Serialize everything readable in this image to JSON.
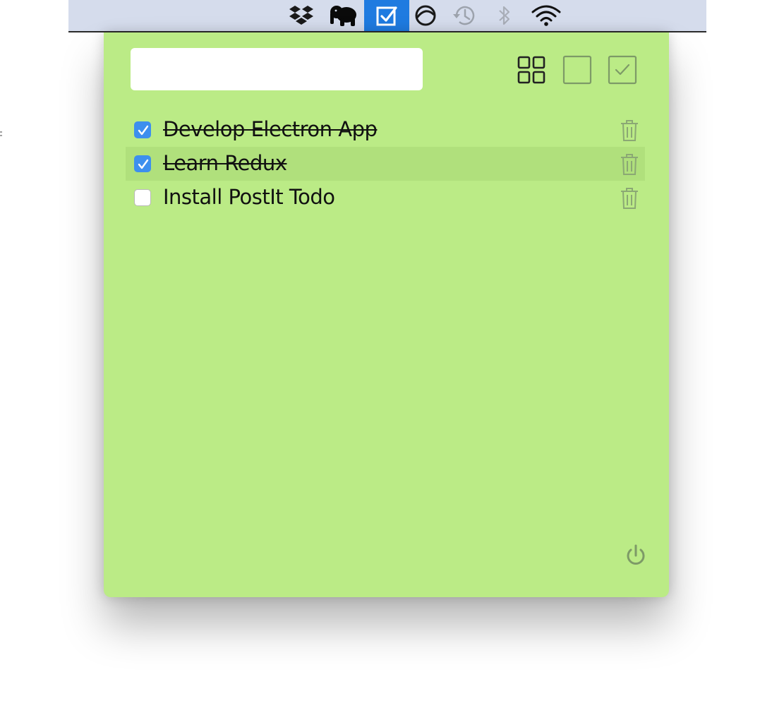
{
  "menubar": {
    "icons": [
      {
        "name": "dropbox-icon",
        "active": false
      },
      {
        "name": "evernote-elephant-icon",
        "active": false
      },
      {
        "name": "postit-todo-checkbox-icon",
        "active": true
      },
      {
        "name": "sync-circle-icon",
        "active": false
      },
      {
        "name": "time-machine-icon",
        "active": false
      },
      {
        "name": "bluetooth-icon",
        "active": false
      },
      {
        "name": "wifi-icon",
        "active": false
      }
    ],
    "colors": {
      "bar": "#d5dcec",
      "active": "#1f7be0"
    }
  },
  "app": {
    "background": "#bbeb86",
    "new_todo": {
      "value": "",
      "placeholder": ""
    },
    "filters": [
      {
        "name": "all-filter",
        "icon": "grid-icon",
        "selected": true
      },
      {
        "name": "active-filter",
        "icon": "empty-square-icon",
        "selected": false
      },
      {
        "name": "completed-filter",
        "icon": "checked-square-icon",
        "selected": false
      }
    ],
    "todos": [
      {
        "text": "Develop Electron App",
        "completed": true
      },
      {
        "text": "Learn Redux",
        "completed": true
      },
      {
        "text": "Install PostIt Todo",
        "completed": false
      }
    ],
    "footer": {
      "icon": "power-icon"
    }
  }
}
